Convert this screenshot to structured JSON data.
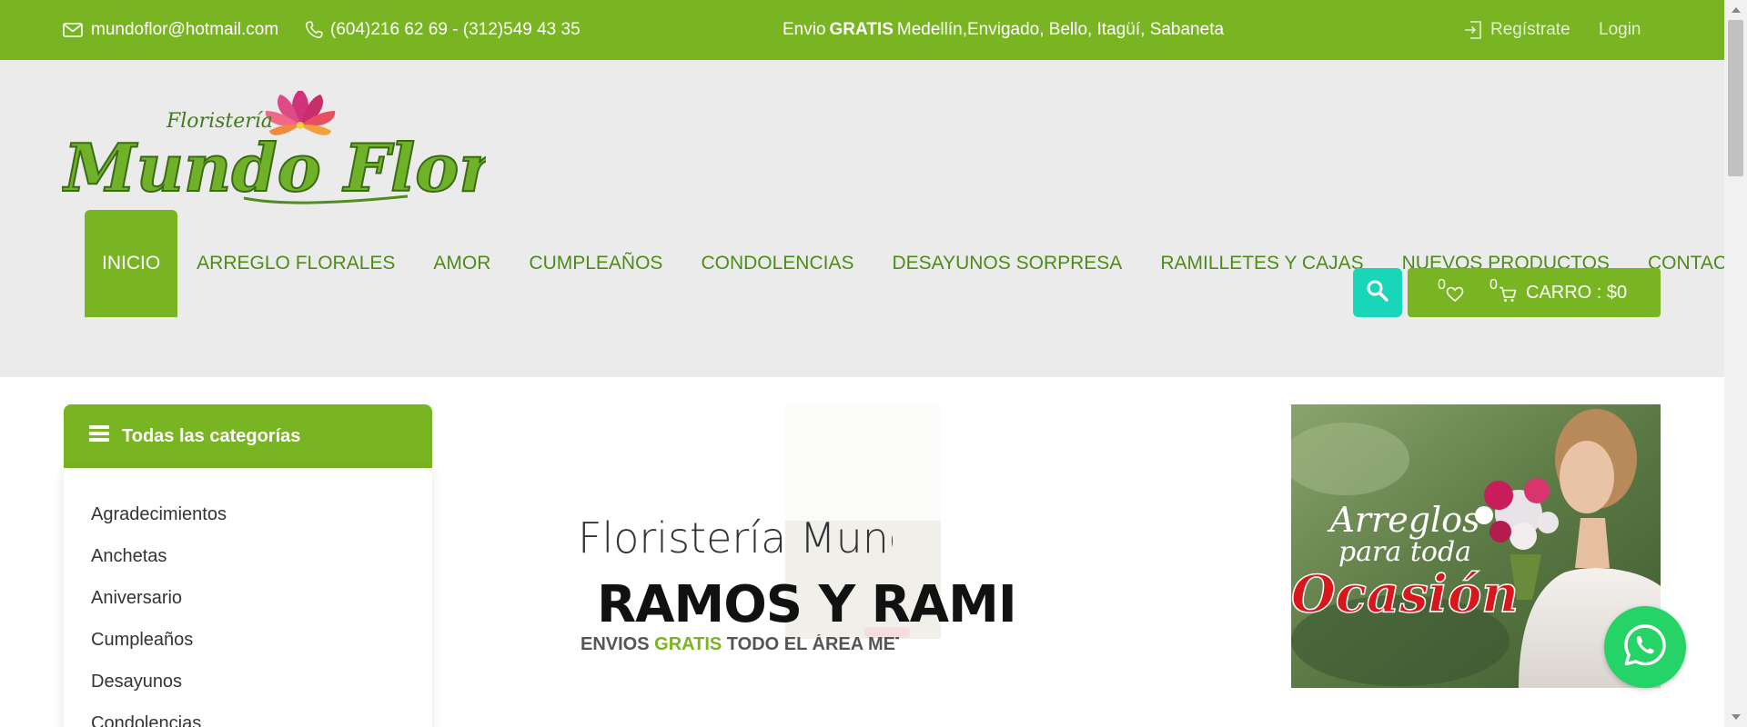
{
  "topbar": {
    "email": "mundoflor@hotmail.com",
    "phone": "(604)216 62 69 - (312)549 43 35",
    "shipping_prefix": "Envio",
    "shipping_bold": "GRATIS",
    "shipping_rest": "Medellín,Envigado, Bello, Itagüí, Sabaneta",
    "register_label": "Regístrate",
    "login_label": "Login",
    "email_icon": "mail-icon",
    "phone_icon": "phone-icon",
    "register_icon": "sign-in-icon"
  },
  "logo": {
    "small_text": "Floristería",
    "main_text": "Mundo Flor"
  },
  "nav": {
    "items": [
      {
        "label": "INICIO",
        "active": true
      },
      {
        "label": "ARREGLO FLORALES"
      },
      {
        "label": "AMOR"
      },
      {
        "label": "CUMPLEAÑOS"
      },
      {
        "label": "CONDOLENCIAS"
      },
      {
        "label": "DESAYUNOS SORPRESA"
      },
      {
        "label": "RAMILLETES Y CAJAS"
      },
      {
        "label": "NUEVOS PRODUCTOS"
      },
      {
        "label": "CONTACTO"
      }
    ]
  },
  "header_tools": {
    "search_icon": "search-icon",
    "wishlist_count": "0",
    "cart_count": "0",
    "cart_label": "CARRO : $0",
    "wishlist_icon": "heart-icon",
    "cart_icon": "cart-icon"
  },
  "sidebar": {
    "title": "Todas las categorías",
    "icon": "menu-icon",
    "items": [
      "Agradecimientos",
      "Anchetas",
      "Aniversario",
      "Cumpleaños",
      "Desayunos",
      "Condolencias"
    ]
  },
  "hero": {
    "subtitle": "Floristería Munc",
    "title": "RAMOS Y RAMIL",
    "shipping_prefix": "ENVIOS",
    "shipping_green": "GRATIS",
    "shipping_rest": "TODO EL ÁREA MET"
  },
  "promo": {
    "line1": "Arreglos",
    "line2": "para toda",
    "line3": "Ocasión"
  },
  "whatsapp_icon": "whatsapp-icon",
  "colors": {
    "brand_green": "#79b523",
    "nav_text": "#4f8b1a",
    "search_teal": "#19d6b8",
    "header_bg": "#ebebeb",
    "whatsapp_green": "#25d366",
    "promo_red": "#d9161c"
  }
}
